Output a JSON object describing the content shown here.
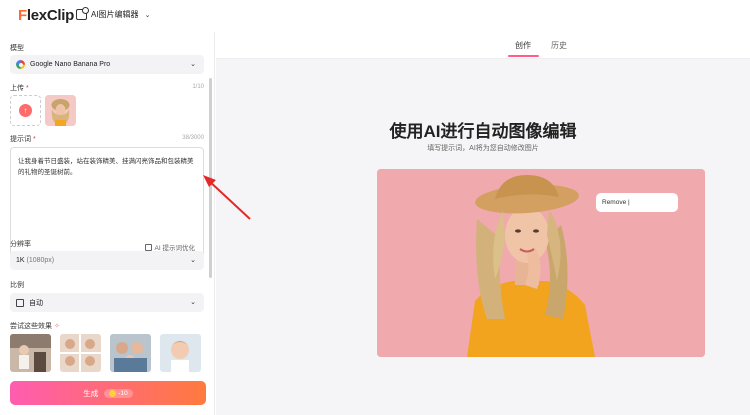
{
  "header": {
    "logo_prefix": "F",
    "logo_rest": "lexClip",
    "tool_name": "AI图片编辑器"
  },
  "left": {
    "model_label": "模型",
    "model_value": "Google Nano Banana Pro",
    "upload_label": "上传",
    "upload_count": "1/10",
    "prompt_label": "提示词",
    "prompt_count": "38/3000",
    "prompt_text": "让我身着节日盛装，站在装饰精美、挂满闪亮饰品和包装精美的礼物的圣诞树前。",
    "optimize_label": "AI 提示词优化",
    "resolution_label": "分辨率",
    "resolution_value": "1K",
    "resolution_detail": "(1080px)",
    "ratio_label": "比例",
    "ratio_value": "自动",
    "effects_label": "尝试这些效果",
    "generate_label": "生成",
    "generate_cost": "-10"
  },
  "right": {
    "tabs": [
      {
        "label": "创作",
        "active": true
      },
      {
        "label": "历史",
        "active": false
      }
    ],
    "title": "使用AI进行自动图像编辑",
    "subtitle": "填写提示词，AI将为您自动修改图片",
    "demo_input": "Remove |"
  },
  "colors": {
    "brand": "#ff6b2c",
    "accent_pink": "#ff5cb0",
    "accent_orange": "#ff7a3d",
    "tab_underline": "#ff5c8a",
    "demo_bg": "#f0a9ad",
    "annotation_arrow": "#e22a2a"
  }
}
